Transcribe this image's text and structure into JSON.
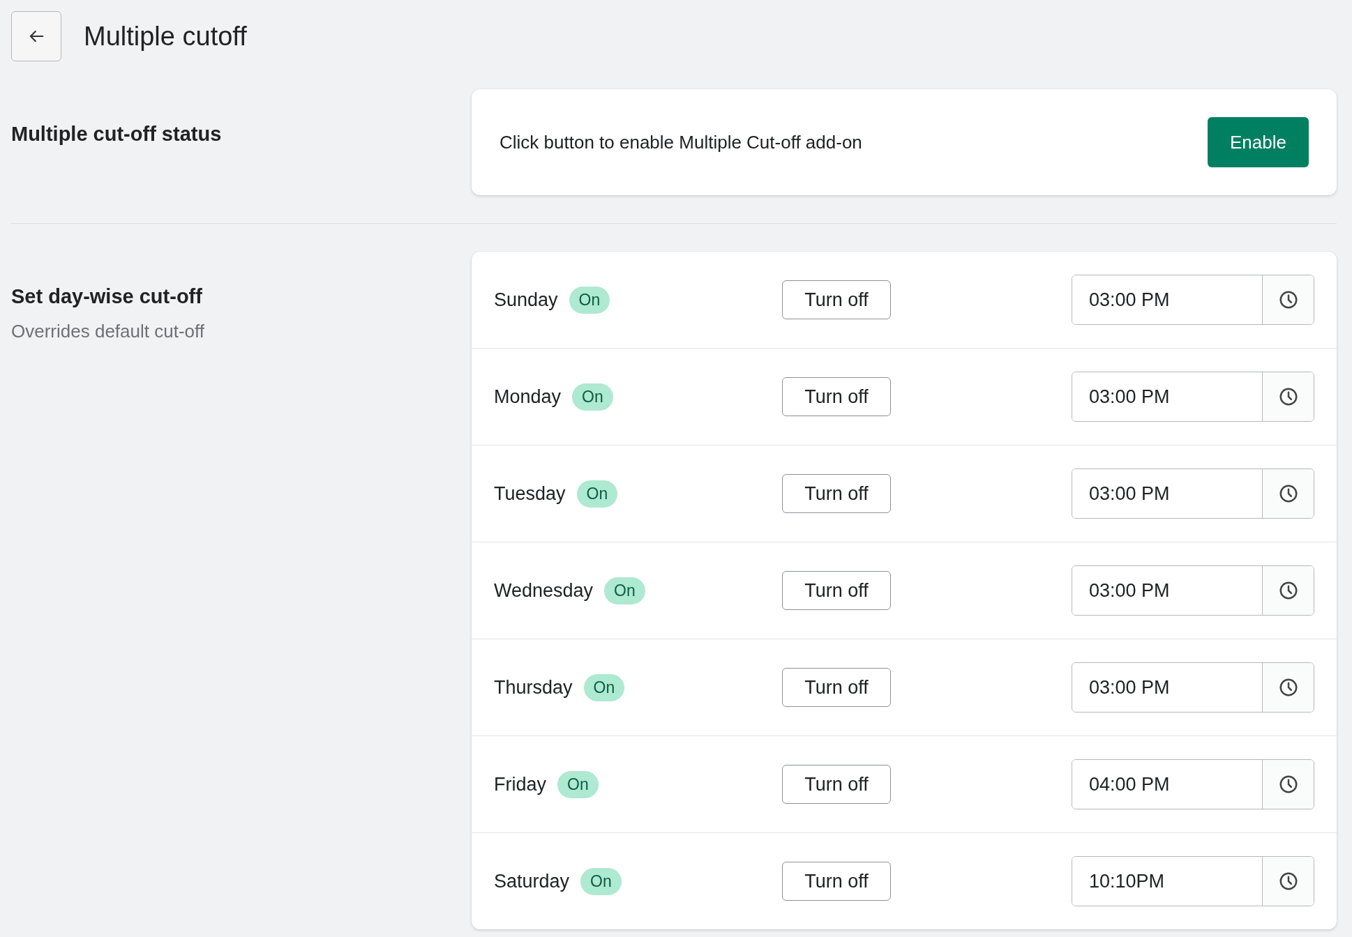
{
  "header": {
    "title": "Multiple cutoff"
  },
  "status_section": {
    "title": "Multiple cut-off status",
    "message": "Click button to enable Multiple Cut-off add-on",
    "button": "Enable"
  },
  "daywise_section": {
    "title": "Set day-wise cut-off",
    "subtitle": "Overrides default cut-off",
    "days": [
      {
        "day": "Sunday",
        "badge": "On",
        "action": "Turn off",
        "time": "03:00 PM"
      },
      {
        "day": "Monday",
        "badge": "On",
        "action": "Turn off",
        "time": "03:00 PM"
      },
      {
        "day": "Tuesday",
        "badge": "On",
        "action": "Turn off",
        "time": "03:00 PM"
      },
      {
        "day": "Wednesday",
        "badge": "On",
        "action": "Turn off",
        "time": "03:00 PM"
      },
      {
        "day": "Thursday",
        "badge": "On",
        "action": "Turn off",
        "time": "03:00 PM"
      },
      {
        "day": "Friday",
        "badge": "On",
        "action": "Turn off",
        "time": "04:00 PM"
      },
      {
        "day": "Saturday",
        "badge": "On",
        "action": "Turn off",
        "time": "10:10PM"
      }
    ]
  }
}
